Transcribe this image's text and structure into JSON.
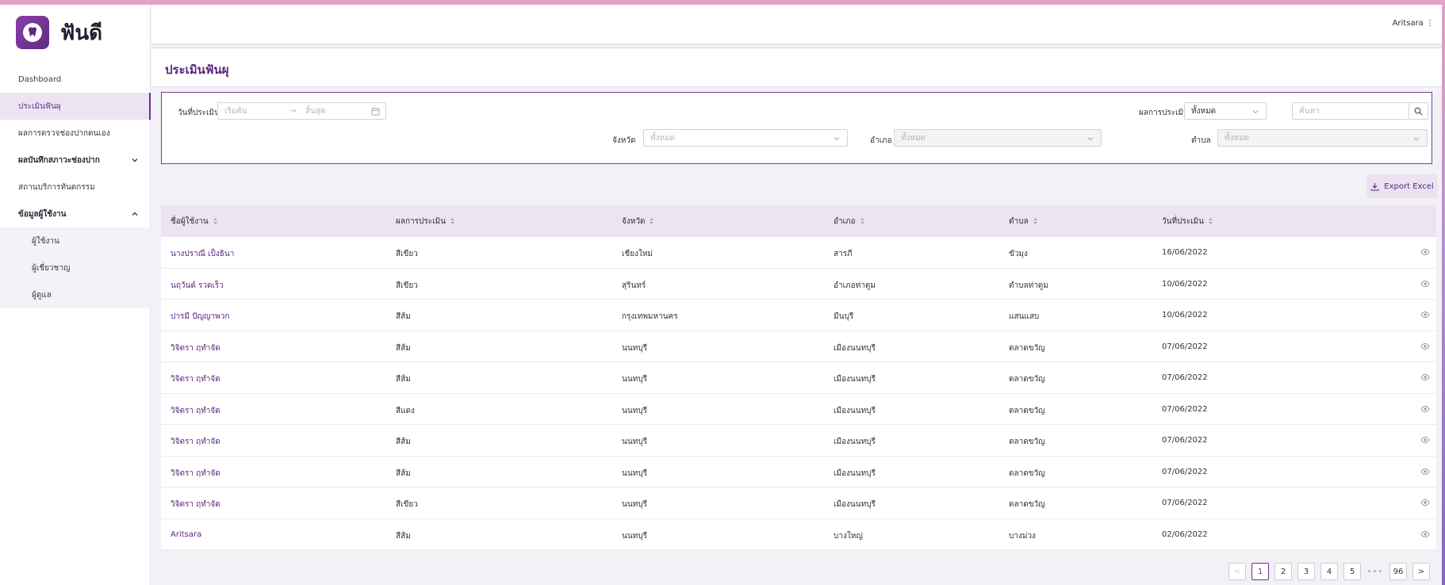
{
  "app": {
    "name": "ฟันดี"
  },
  "topbar": {
    "user": "Aritsara ⋮"
  },
  "sidebar": {
    "items": [
      {
        "label": "Dashboard"
      },
      {
        "label": "ประเมินฟันผุ"
      },
      {
        "label": "ผลการตรวจช่องปากตนเอง"
      },
      {
        "label": "ผลบันทึกสภาวะช่องปาก"
      },
      {
        "label": "สถานบริการทันตกรรม"
      },
      {
        "label": "ข้อมูลผู้ใช้งาน"
      }
    ],
    "subitems": [
      {
        "label": "ผู้ใช้งาน"
      },
      {
        "label": "ผู้เชี่ยวชาญ"
      },
      {
        "label": "ผู้ดูแล"
      }
    ]
  },
  "page": {
    "title": "ประเมินฟันผุ"
  },
  "filters": {
    "date_label": "วันที่ประเมิน",
    "date_start_placeholder": "เริ่มต้น",
    "date_end_placeholder": "สิ้นสุด",
    "date_arrow": "→",
    "result_label": "ผลการประเมิน",
    "result_value": "ทั้งหมด",
    "search_placeholder": "ค้นหา",
    "province_label": "จังหวัด",
    "province_placeholder": "ทั้งหมด",
    "district_label": "อำเภอ",
    "district_placeholder": "ทั้งหมด",
    "subdistrict_label": "ตำบล",
    "subdistrict_placeholder": "ทั้งหมด"
  },
  "export": {
    "label": "Export Excel"
  },
  "table": {
    "headers": [
      "ชื่อผู้ใช้งาน",
      "ผลการประเมิน",
      "จังหวัด",
      "อำเภอ",
      "ตำบล",
      "วันที่ประเมิน"
    ],
    "rows": [
      [
        "นางปราณี เป็งธินา",
        "สีเขียว",
        "เชียงใหม่",
        "สารภี",
        "ขัวมุง",
        "16/06/2022"
      ],
      [
        "นฤวันต์ รวดเร็ว",
        "สีเขียว",
        "สุรินทร์",
        "อำเภอท่าตูม",
        "ตำบลท่าตูม",
        "10/06/2022"
      ],
      [
        "ปารมี ปัญญาพวก",
        "สีส้ม",
        "กรุงเทพมหานคร",
        "มีนบุรี",
        "แสนแสบ",
        "10/06/2022"
      ],
      [
        "วิจิตรา ฤทำจัด",
        "สีส้ม",
        "นนทบุรี",
        "เมืองนนทบุรี",
        "ตลาดขวัญ",
        "07/06/2022"
      ],
      [
        "วิจิตรา ฤทำจัด",
        "สีส้ม",
        "นนทบุรี",
        "เมืองนนทบุรี",
        "ตลาดขวัญ",
        "07/06/2022"
      ],
      [
        "วิจิตรา ฤทำจัด",
        "สีแดง",
        "นนทบุรี",
        "เมืองนนทบุรี",
        "ตลาดขวัญ",
        "07/06/2022"
      ],
      [
        "วิจิตรา ฤทำจัด",
        "สีส้ม",
        "นนทบุรี",
        "เมืองนนทบุรี",
        "ตลาดขวัญ",
        "07/06/2022"
      ],
      [
        "วิจิตรา ฤทำจัด",
        "สีส้ม",
        "นนทบุรี",
        "เมืองนนทบุรี",
        "ตลาดขวัญ",
        "07/06/2022"
      ],
      [
        "วิจิตรา ฤทำจัด",
        "สีเขียว",
        "นนทบุรี",
        "เมืองนนทบุรี",
        "ตลาดขวัญ",
        "07/06/2022"
      ],
      [
        "Aritsara",
        "สีส้ม",
        "นนทบุรี",
        "บางใหญ่",
        "บางม่วง",
        "02/06/2022"
      ]
    ]
  },
  "pagination": {
    "prev": "<",
    "pages": [
      "1",
      "2",
      "3",
      "4",
      "5"
    ],
    "ellipsis": "•••",
    "last": "96",
    "next": ">"
  },
  "colors": {
    "brand": "#6b2f8f",
    "header_bg": "#ece4f2"
  }
}
